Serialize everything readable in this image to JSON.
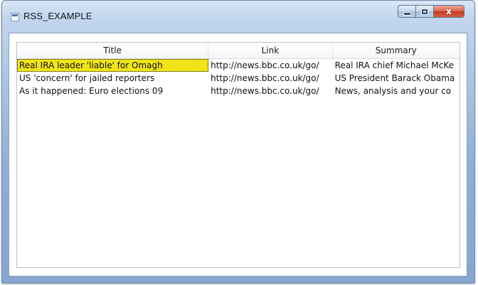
{
  "window": {
    "title": "RSS_EXAMPLE",
    "buttons": {
      "close_glyph": "x"
    }
  },
  "table": {
    "columns": [
      "Title",
      "Link",
      "Summary"
    ],
    "rows": [
      {
        "title": "Real IRA leader 'liable' for Omagh",
        "link": "http://news.bbc.co.uk/go/",
        "summary": "Real IRA chief Michael McKe",
        "selected": true
      },
      {
        "title": "US 'concern' for jailed reporters",
        "link": "http://news.bbc.co.uk/go/",
        "summary": "US President Barack Obama",
        "selected": false
      },
      {
        "title": "As it happened: Euro elections 09",
        "link": "http://news.bbc.co.uk/go/",
        "summary": "News, analysis and your co",
        "selected": false
      }
    ]
  },
  "colors": {
    "selection": "#f0e419",
    "close_button": "#c23b22",
    "frame": "#8eaed6"
  }
}
